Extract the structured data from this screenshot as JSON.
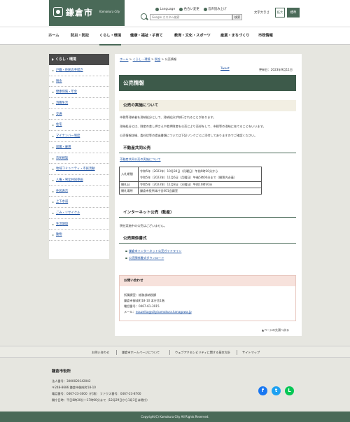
{
  "header": {
    "logo_name": "鎌倉市",
    "logo_sub": "Kamakura City",
    "util_links": [
      {
        "label": "Language",
        "icon": "globe-icon"
      },
      {
        "label": "色合い変更",
        "icon": "palette-icon"
      },
      {
        "label": "音声読み上げ",
        "icon": "speaker-icon"
      }
    ],
    "search_placeholder": "Google カスタム検索",
    "search_button": "検索",
    "text_size_label": "文字大きさ",
    "text_size_large": "拡大",
    "text_size_standard": "標準",
    "brand_color": "#4a6a58"
  },
  "nav": {
    "items": [
      "ホーム",
      "防災・防犯",
      "くらし・環境",
      "健康・福祉・子育て",
      "教育・文化・スポーツ",
      "産業・まちづくり",
      "市政情報"
    ],
    "active_index": 2
  },
  "sidebar": {
    "heading": "くらし・環境",
    "items": [
      "戸籍・住民の手続き",
      "税金",
      "健康保険・年金",
      "消費生活",
      "交通",
      "住宅",
      "マイナンバー制度",
      "就職・雇用",
      "市民相談",
      "地域コミュニティ・市民活動",
      "人権・男女共同参画",
      "住居表示",
      "上下水道",
      "ごみ・リサイクル",
      "生活環境",
      "動物"
    ]
  },
  "main": {
    "breadcrumb": [
      "ホーム",
      "くらし・環境",
      "税金",
      "公売情報"
    ],
    "breadcrumb_sep": " > ",
    "tweet": "Tweet",
    "updated": "更新日：2023年9月11日",
    "title": "公売情報",
    "section1": {
      "heading": "公売の実施について",
      "paras": [
        "市税等滞納者を滞納処分として、滞納処分が執行されることがあります。",
        "滞納処分とは、財産の差し押さえや差押財産を公売により売却をして、市税等の滞納に充てることをいいます。",
        "公売情報詳細、委任状等の提出書類については下記リンクごとに添付してありますのでご確認ください。"
      ]
    },
    "section2": {
      "heading": "不動産共同公売",
      "link": "不動産共同公売の実施について",
      "rows": [
        {
          "key": "入札期間",
          "values": [
            "令和5年（2023年）10月30日（月曜日）午前9時30分から",
            "令和5年（2023年）11月6日（月曜日）午後5時00分まで（開票内必着）"
          ]
        },
        {
          "key": "開札日",
          "values": [
            "令和5年（2023年）11月8日（水曜日）午前10時30分"
          ]
        },
        {
          "key": "開札場所",
          "values": [
            "鎌倉市役所本庁舎401会議室"
          ]
        }
      ]
    },
    "section3": {
      "heading": "インターネット公売（動産）",
      "para": "現在実施中の公売はございません。"
    },
    "section4": {
      "heading": "公売関係書式",
      "links": [
        "鎌倉市インターネット公売ガイドライン",
        "公売関係書式ダウンロード"
      ]
    },
    "contact": {
      "heading": "お問い合わせ",
      "lines": [
        "所属課室：総務部納税課",
        "鎌倉市御成町18-10 本庁舎1階",
        "電話番号：0467-61-3915"
      ],
      "mail_label": "メール：",
      "mail": "nouzeika@city.kamakura.kanagawa.jp"
    },
    "page_top": "ページの先頭へ戻る"
  },
  "footer": {
    "links": [
      "お問い合わせ",
      "鎌倉市ホームページについて",
      "ウェブアクセシビリティに関する基本方針",
      "サイトマップ"
    ],
    "office_name": "鎌倉市役所",
    "lines": [
      "法人番号：3000020142042",
      "〒248-8686 鎌倉市御成町18-10",
      "電話番号：0467-23-3000（代表） ファクス番号：0467-23-8700",
      "開庁日時：平日8時30分～17時00分まで（12月29日から1月3日は閉庁）"
    ],
    "sns": [
      {
        "name": "facebook-icon",
        "glyph": "f",
        "color": "#1877f2"
      },
      {
        "name": "twitter-icon",
        "glyph": "t",
        "color": "#1da1f2"
      },
      {
        "name": "line-icon",
        "glyph": "L",
        "color": "#06c755"
      }
    ],
    "copyright": "Copyright(C) Kamakura City All Rights Reserved."
  }
}
